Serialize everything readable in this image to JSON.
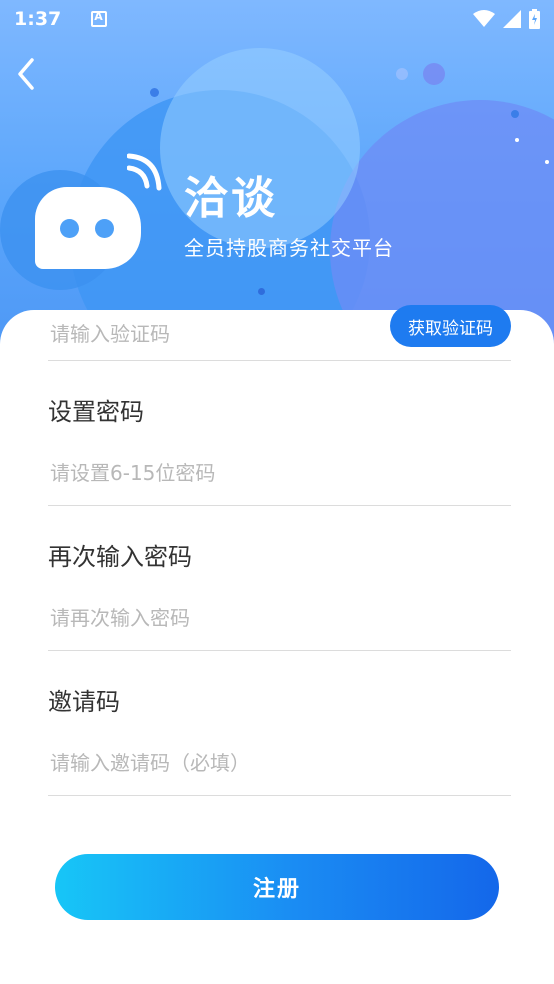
{
  "status_bar": {
    "time": "1:37",
    "icons": [
      "app-icon",
      "wifi-icon",
      "signal-icon",
      "battery-icon"
    ]
  },
  "header": {
    "back_icon": "chevron-left-icon",
    "app_name": "洽谈",
    "slogan": "全员持股商务社交平台"
  },
  "form": {
    "verification_code": {
      "placeholder": "请输入验证码",
      "button_label": "获取验证码"
    },
    "password": {
      "label": "设置密码",
      "placeholder": "请设置6-15位密码"
    },
    "confirm_password": {
      "label": "再次输入密码",
      "placeholder": "请再次输入密码"
    },
    "invite_code": {
      "label": "邀请码",
      "placeholder": "请输入邀请码（必填）"
    }
  },
  "register_button": "注册",
  "colors": {
    "primary": "#1e7bf0",
    "gradient_start": "#17c6f7",
    "gradient_end": "#1467ea",
    "header_bg": "#5ba6fb"
  }
}
